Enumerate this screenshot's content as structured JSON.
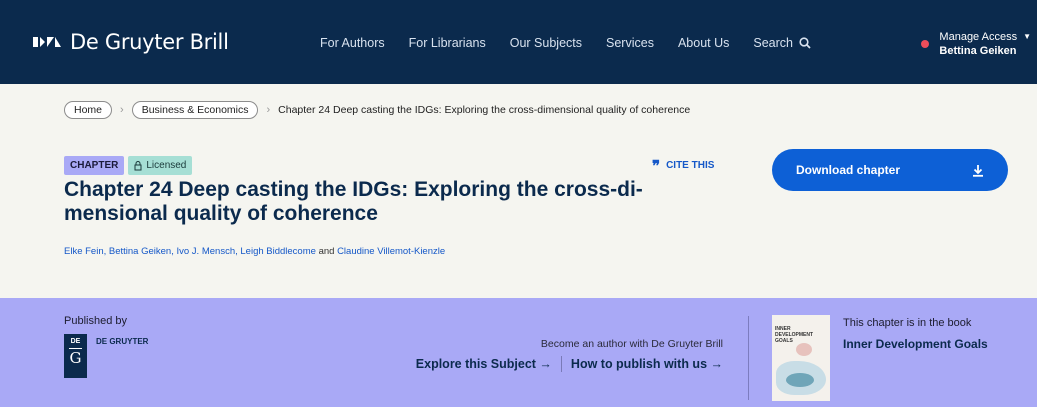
{
  "header": {
    "brand": "De Gruyter Brill",
    "nav": [
      "For Authors",
      "For Librarians",
      "Our Subjects",
      "Services",
      "About Us"
    ],
    "search_label": "Search",
    "account": {
      "label": "Manage Access",
      "user": "Bettina Geiken"
    }
  },
  "breadcrumb": {
    "home": "Home",
    "category": "Business & Economics",
    "current": "Chapter 24 Deep casting the IDGs: Exploring the cross-dimensional quality of coherence"
  },
  "article": {
    "type_badge": "CHAPTER",
    "license_badge": "Licensed",
    "cite_label": "CITE THIS",
    "title": "Chapter 24 Deep casting the IDGs: Exploring the cross-di-mensional quality of coherence",
    "authors": [
      "Elke Fein",
      "Bettina Geiken",
      "Ivo J. Mensch",
      "Leigh Biddlecome"
    ],
    "authors_joiner": "and",
    "last_author": "Claudine Villemot-Kienzle",
    "download_label": "Download chapter"
  },
  "publisher": {
    "label": "Published by",
    "logo_top": "DE",
    "logo_letter": "G",
    "name": "DE GRUYTER"
  },
  "author_cta": {
    "text": "Become an author with De Gruyter Brill",
    "link1": "Explore this Subject →",
    "link2": "How to publish with us →"
  },
  "book": {
    "note": "This chapter is in the book",
    "title": "Inner Development Goals",
    "cover_text": "INNER DEVELOPMENT GOALS"
  },
  "colors": {
    "header_bg": "#0b2a4d",
    "accent_blue": "#0d60d6",
    "band_bg": "#a9a9f6",
    "licensed_bg": "#a6dfd5"
  }
}
